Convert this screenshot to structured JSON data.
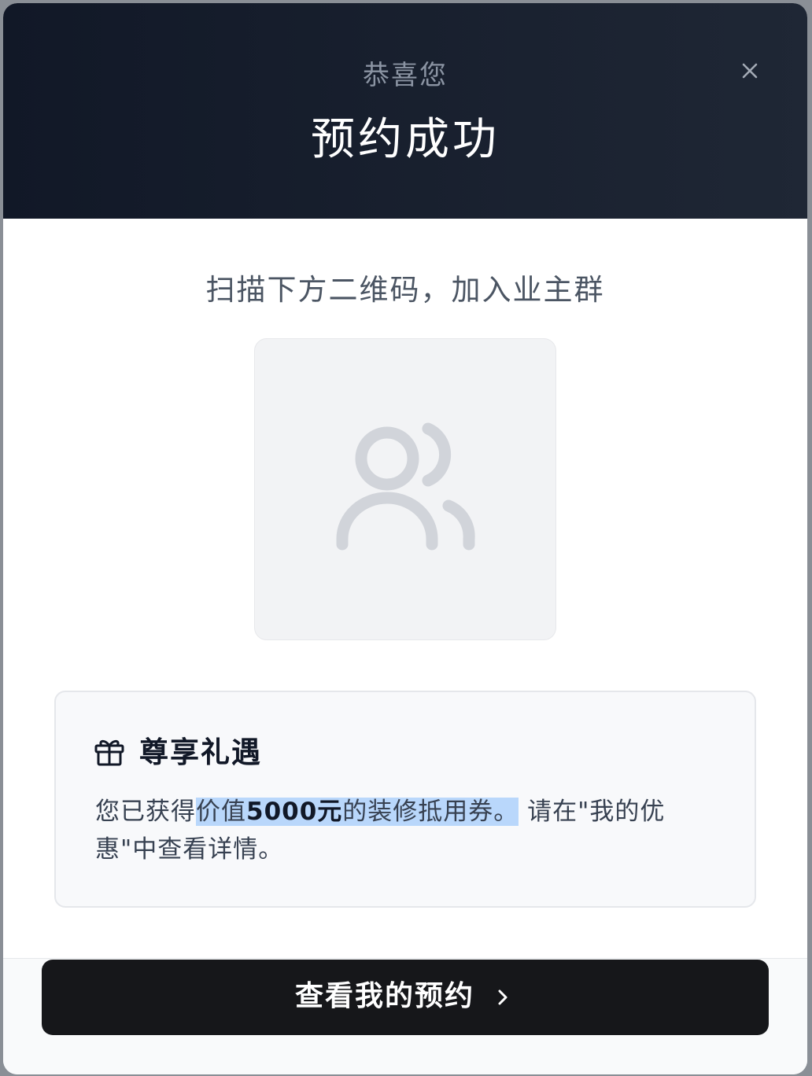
{
  "header": {
    "subtitle": "恭喜您",
    "title": "预约成功",
    "close_icon": "close-icon"
  },
  "qr_section": {
    "instruction": "扫描下方二维码，加入业主群",
    "placeholder_icon": "users-icon"
  },
  "gift": {
    "icon": "gift-icon",
    "title": "尊享礼遇",
    "text_prefix": "您已获得",
    "text_highlight_a": "价值",
    "text_amount": "5000元",
    "text_highlight_b": "的装修抵用券。",
    "text_suffix": "请在\"我的优惠\"中查看详情。"
  },
  "footer": {
    "button_label": "查看我的预约",
    "button_icon": "chevron-right-icon"
  },
  "colors": {
    "header_bg": "#111827",
    "button_bg": "#16171a",
    "highlight": "#b9d7fb"
  }
}
